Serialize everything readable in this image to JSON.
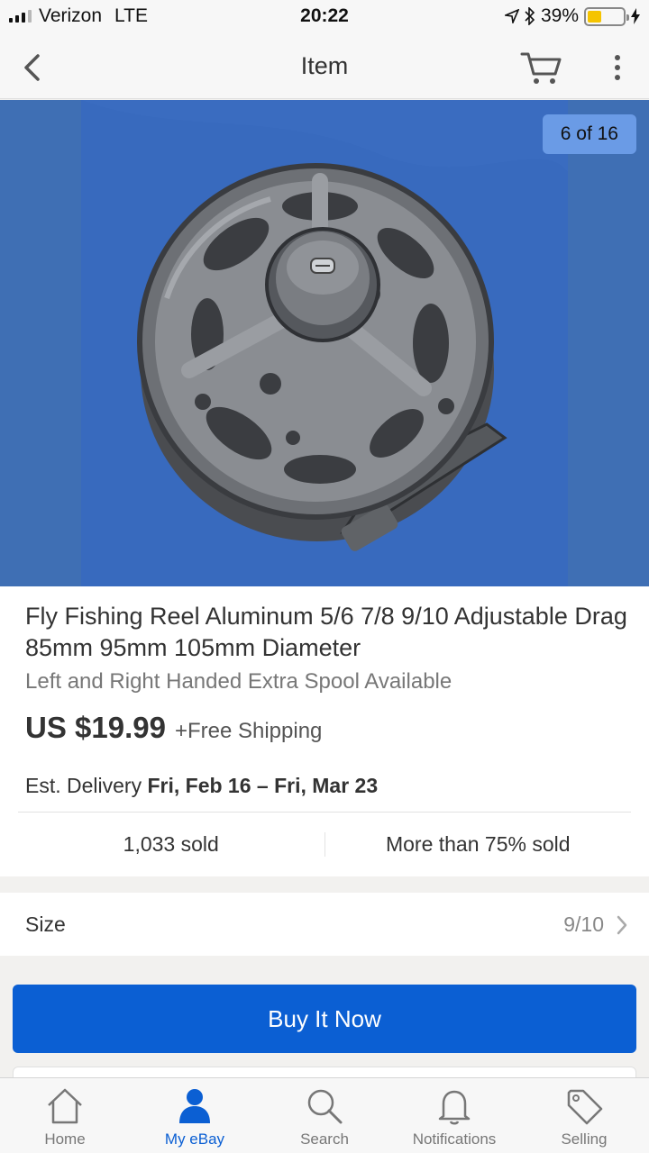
{
  "status_bar": {
    "carrier": "Verizon",
    "network": "LTE",
    "time": "20:22",
    "battery_percent": "39%",
    "battery_level": 0.39
  },
  "nav": {
    "title": "Item"
  },
  "gallery": {
    "counter": "6 of 16",
    "background_color": "#3f6fb4"
  },
  "item": {
    "title": "Fly Fishing Reel Aluminum 5/6 7/8 9/10 Adjustable Drag 85mm 95mm 105mm Diameter",
    "subtitle": "Left and Right Handed Extra Spool Available",
    "price": "US $19.99",
    "shipping": "+Free Shipping",
    "delivery_label": "Est. Delivery",
    "delivery_dates": "Fri, Feb 16 – Fri, Mar 23",
    "sold_count": "1,033 sold",
    "sold_percent": "More than 75% sold"
  },
  "variation": {
    "label": "Size",
    "value": "9/10"
  },
  "actions": {
    "buy_now": "Buy It Now"
  },
  "tabs": [
    {
      "label": "Home",
      "icon": "home-icon",
      "active": false
    },
    {
      "label": "My eBay",
      "icon": "person-icon",
      "active": true
    },
    {
      "label": "Search",
      "icon": "search-icon",
      "active": false
    },
    {
      "label": "Notifications",
      "icon": "bell-icon",
      "active": false
    },
    {
      "label": "Selling",
      "icon": "tag-icon",
      "active": false
    }
  ],
  "colors": {
    "primary": "#0b5fd3",
    "battery": "#f5c400"
  }
}
